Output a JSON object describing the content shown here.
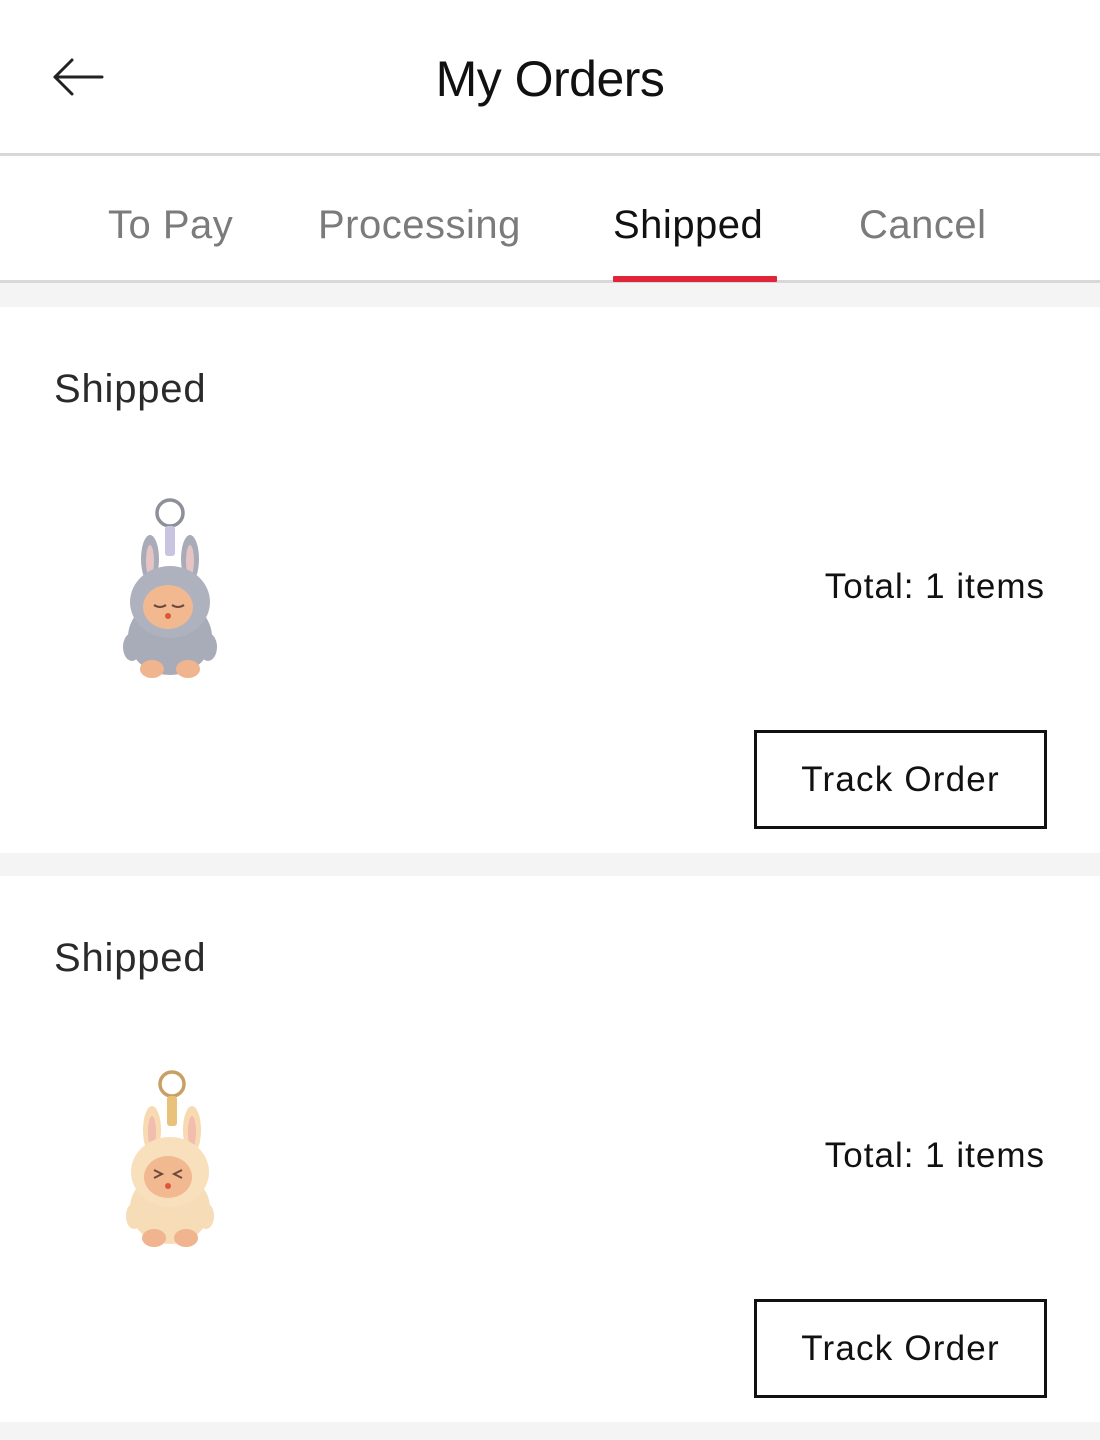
{
  "header": {
    "title": "My Orders",
    "back_icon": "arrow-left-icon"
  },
  "tabs": [
    {
      "label": "To Pay",
      "active": false
    },
    {
      "label": "Processing",
      "active": false
    },
    {
      "label": "Shipped",
      "active": true
    },
    {
      "label": "Cancel",
      "active": false
    }
  ],
  "colors": {
    "accent": "#e0243a",
    "page_bg": "#f4f4f4",
    "text": "#111111",
    "tab_inactive": "#7b7b7b"
  },
  "orders": [
    {
      "status": "Shipped",
      "total": "Total: 1 items",
      "button": "Track Order",
      "product_icon": "gray-bunny-plush-keychain"
    },
    {
      "status": "Shipped",
      "total": "Total: 1 items",
      "button": "Track Order",
      "product_icon": "peach-bunny-plush-keychain"
    }
  ]
}
